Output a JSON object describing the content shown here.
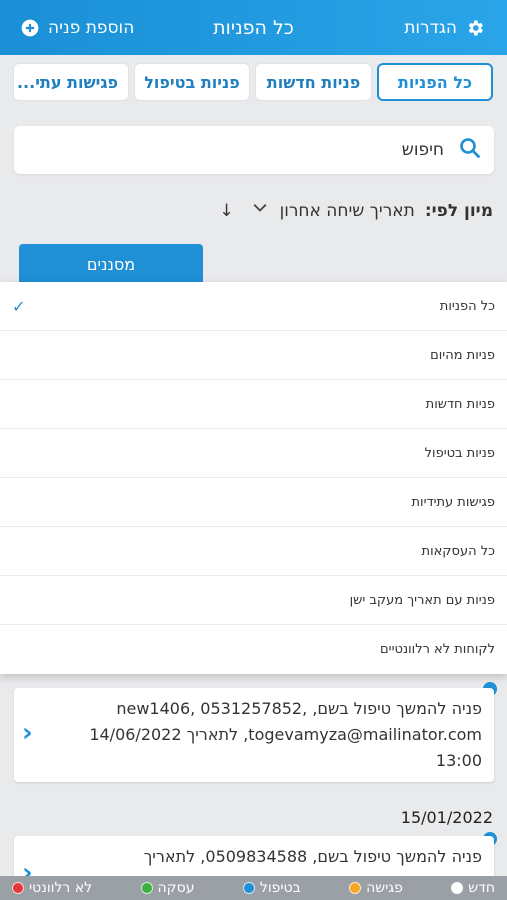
{
  "header": {
    "settings_label": "הגדרות",
    "title": "כל הפניות",
    "add_label": "הוספת פניה",
    "bg_color": "#1f8fd6"
  },
  "tabs": [
    {
      "label": "כל הפניות",
      "active": true
    },
    {
      "label": "פניות חדשות",
      "active": false
    },
    {
      "label": "פניות בטיפול",
      "active": false
    },
    {
      "label": "פגישות עתי...",
      "active": false
    }
  ],
  "search": {
    "placeholder": "חיפוש",
    "icon": "search-icon"
  },
  "sort": {
    "label": "מיון לפי:",
    "value": "תאריך שיחה אחרון",
    "direction_icon": "↓"
  },
  "filter_button": {
    "label": "מסננים"
  },
  "menu": {
    "items": [
      {
        "label": "כל הפניות",
        "selected": true
      },
      {
        "label": "פניות מהיום",
        "selected": false
      },
      {
        "label": "פניות חדשות",
        "selected": false
      },
      {
        "label": "פניות בטיפול",
        "selected": false
      },
      {
        "label": "פגישות עתידיות",
        "selected": false
      },
      {
        "label": "כל העסקאות",
        "selected": false
      },
      {
        "label": "פניות עם תאריך מעקב ישן",
        "selected": false
      },
      {
        "label": "לקוחות לא רלוונטיים",
        "selected": false
      }
    ]
  },
  "cards": [
    {
      "text": "פניה להמשך טיפול בשם, new1406, 0531257852, togevamyza@mailinator.com, לתאריך 14/06/2022 13:00"
    },
    {
      "date": "15/01/2022",
      "text": "פניה להמשך טיפול בשם, 0509834588, לתאריך"
    }
  ],
  "legend": [
    {
      "label": "חדש",
      "color": "#ffffff"
    },
    {
      "label": "פגישה",
      "color": "#f5a623"
    },
    {
      "label": "בטיפול",
      "color": "#1f8fd6"
    },
    {
      "label": "עסקה",
      "color": "#3cb043"
    },
    {
      "label": "לא רלוונטי",
      "color": "#e53935"
    }
  ]
}
